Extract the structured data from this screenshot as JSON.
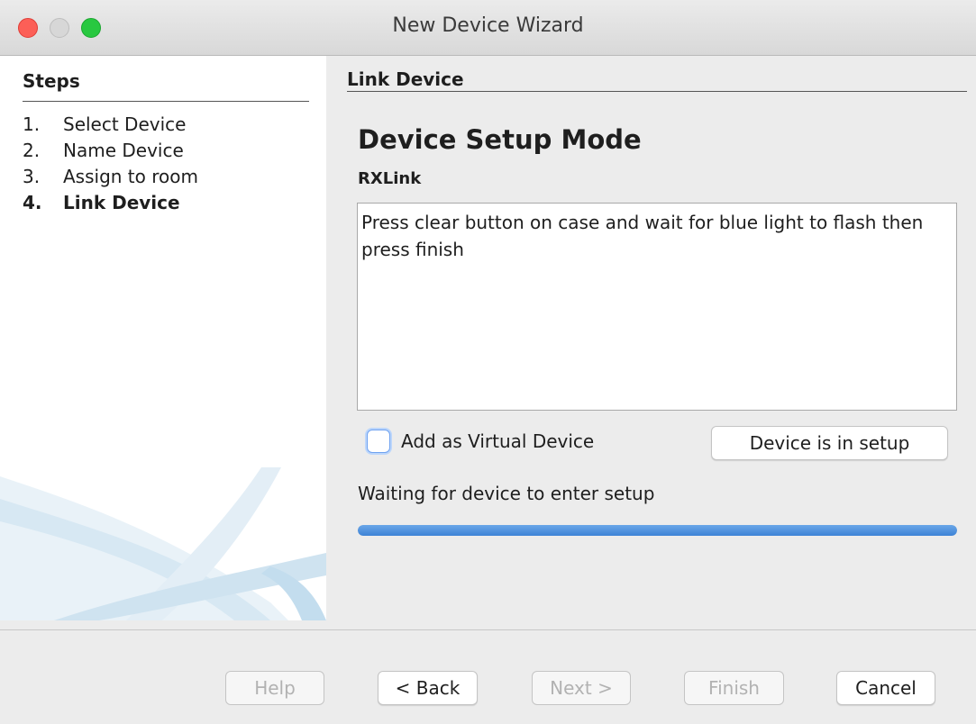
{
  "window": {
    "title": "New Device Wizard",
    "traffic_colors": {
      "close": "#fc5f57",
      "minimize": "#d7d7d7",
      "maximize": "#28c840"
    }
  },
  "steps": {
    "heading": "Steps",
    "items": [
      {
        "number": "1.",
        "label": "Select Device",
        "active": false
      },
      {
        "number": "2.",
        "label": "Name Device",
        "active": false
      },
      {
        "number": "3.",
        "label": "Assign to room",
        "active": false
      },
      {
        "number": "4.",
        "label": "Link Device",
        "active": true
      }
    ]
  },
  "content": {
    "section_heading": "Link Device",
    "title": "Device Setup Mode",
    "device_name": "RXLink",
    "instructions": "Press clear button on case and wait for blue light to flash then press finish",
    "virtual_checkbox": {
      "label": "Add as Virtual Device",
      "checked": false
    },
    "setup_button_label": "Device is in setup",
    "status_text": "Waiting for device to enter setup",
    "progress": {
      "value": 1.0,
      "color": "#4a8edc"
    }
  },
  "footer": {
    "help_label": "Help",
    "back_label": "< Back",
    "next_label": "Next >",
    "finish_label": "Finish",
    "cancel_label": "Cancel"
  }
}
